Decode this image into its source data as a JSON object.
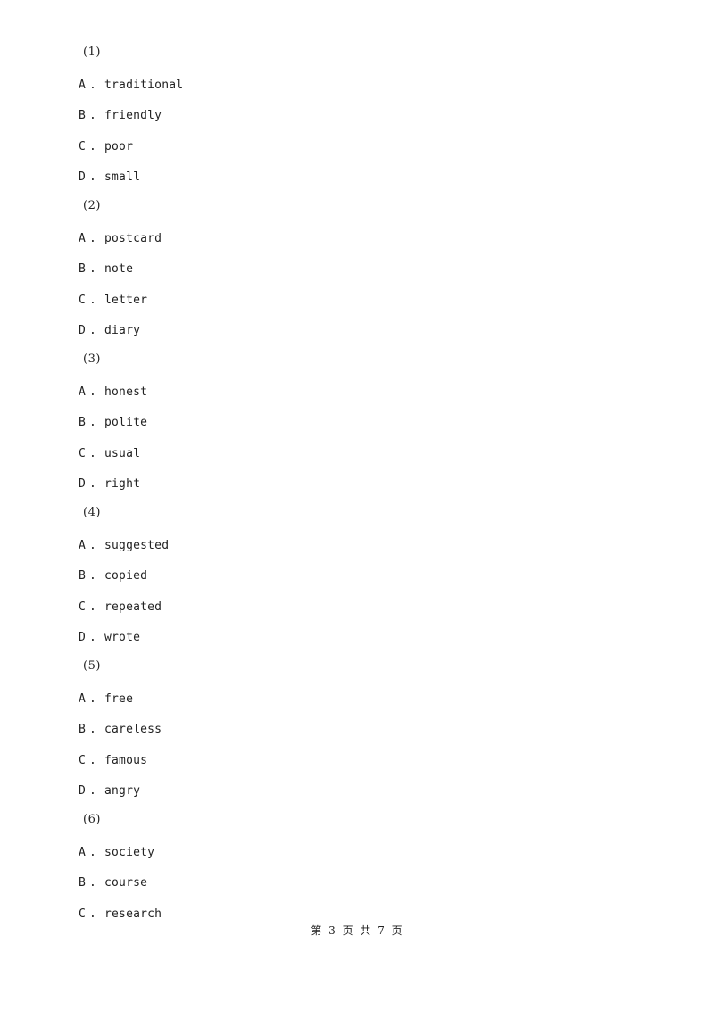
{
  "questions": [
    {
      "number": "(1)",
      "options": [
        {
          "letter": "A",
          "text": "traditional"
        },
        {
          "letter": "B",
          "text": "friendly"
        },
        {
          "letter": "C",
          "text": "poor"
        },
        {
          "letter": "D",
          "text": "small"
        }
      ]
    },
    {
      "number": "(2)",
      "options": [
        {
          "letter": "A",
          "text": "postcard"
        },
        {
          "letter": "B",
          "text": "note"
        },
        {
          "letter": "C",
          "text": "letter"
        },
        {
          "letter": "D",
          "text": "diary"
        }
      ]
    },
    {
      "number": "(3)",
      "options": [
        {
          "letter": "A",
          "text": "honest"
        },
        {
          "letter": "B",
          "text": "polite"
        },
        {
          "letter": "C",
          "text": "usual"
        },
        {
          "letter": "D",
          "text": "right"
        }
      ]
    },
    {
      "number": "(4)",
      "options": [
        {
          "letter": "A",
          "text": "suggested"
        },
        {
          "letter": "B",
          "text": "copied"
        },
        {
          "letter": "C",
          "text": "repeated"
        },
        {
          "letter": "D",
          "text": "wrote"
        }
      ]
    },
    {
      "number": "(5)",
      "options": [
        {
          "letter": "A",
          "text": "free"
        },
        {
          "letter": "B",
          "text": "careless"
        },
        {
          "letter": "C",
          "text": "famous"
        },
        {
          "letter": "D",
          "text": "angry"
        }
      ]
    },
    {
      "number": "(6)",
      "options": [
        {
          "letter": "A",
          "text": "society"
        },
        {
          "letter": "B",
          "text": "course"
        },
        {
          "letter": "C",
          "text": "research"
        }
      ]
    }
  ],
  "option_separator": ".",
  "footer": {
    "text": "第 3 页 共 7 页"
  }
}
